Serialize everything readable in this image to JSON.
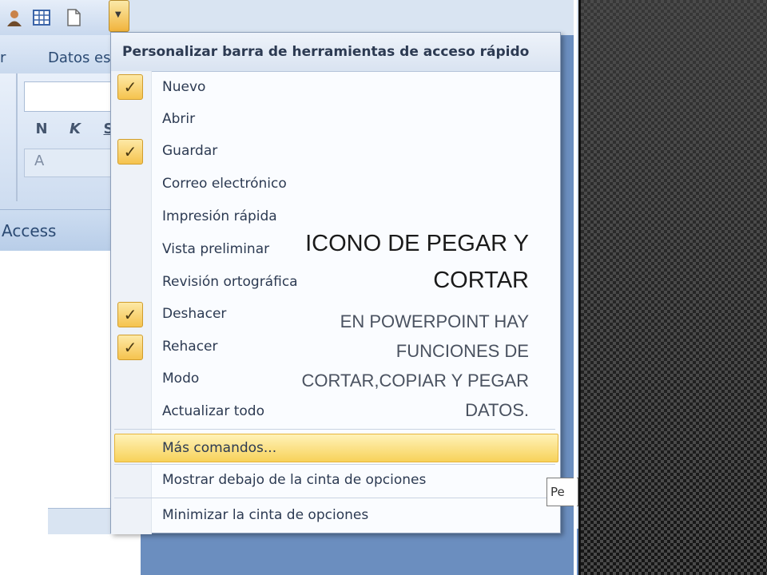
{
  "quick_access_toolbar": {
    "buttons": [
      "user-icon",
      "table-icon",
      "new-document-icon"
    ],
    "dropdown_icon": "chevron-down-icon"
  },
  "ribbon": {
    "tab_left_partial": "r",
    "tab_datos_partial": "Datos es",
    "bold_label": "N",
    "italic_label": "K",
    "underline_partial": "S",
    "font_color_label": "A"
  },
  "access_label": "Access",
  "menu": {
    "title": "Personalizar barra de herramientas de acceso rápido",
    "items": [
      {
        "label": "Nuevo",
        "checked": true
      },
      {
        "label": "Abrir",
        "checked": false
      },
      {
        "label": "Guardar",
        "checked": true
      },
      {
        "label": "Correo electrónico",
        "checked": false
      },
      {
        "label": "Impresión rápida",
        "checked": false
      },
      {
        "label": "Vista preliminar",
        "checked": false
      },
      {
        "label": "Revisión ortográfica",
        "checked": false
      },
      {
        "label": "Deshacer",
        "checked": true
      },
      {
        "label": "Rehacer",
        "checked": true
      },
      {
        "label": "Modo",
        "checked": false
      },
      {
        "label": "Actualizar todo",
        "checked": false
      }
    ],
    "more_commands": "Más comandos...",
    "show_below": "Mostrar debajo de la cinta de opciones",
    "minimize": "Minimizar la cinta de opciones",
    "check_mark": "✓"
  },
  "slide": {
    "title_line1": "ICONO DE PEGAR Y",
    "title_line2": "CORTAR",
    "body_line1": "EN POWERPOINT HAY",
    "body_line2": "FUNCIONES DE",
    "body_line3": "CORTAR,COPIAR Y PEGAR",
    "body_line4": "DATOS."
  },
  "tooltip_partial": "Pe"
}
